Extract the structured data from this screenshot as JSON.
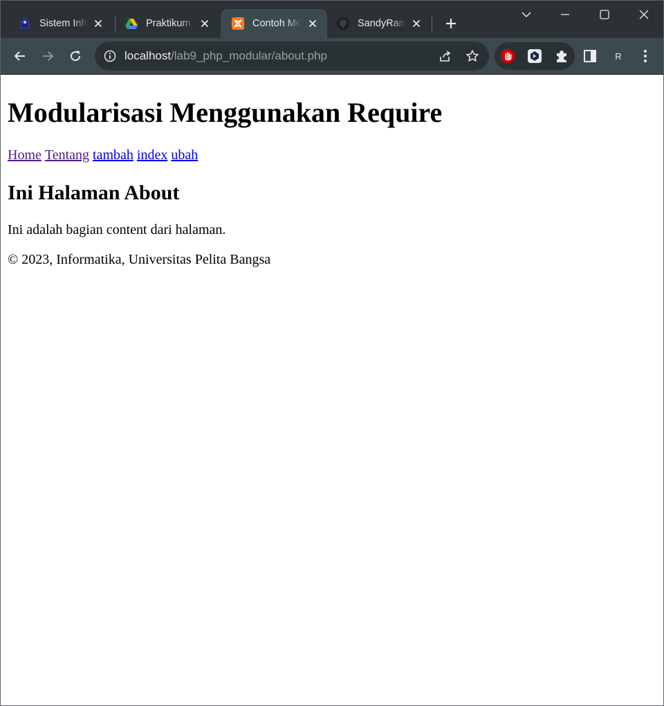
{
  "browser": {
    "tabs": [
      {
        "title": "Sistem Informasi",
        "icon": "university-logo-icon",
        "active": false
      },
      {
        "title": "Praktikum",
        "icon": "google-drive-icon",
        "active": false
      },
      {
        "title": "Contoh Modularisasi",
        "icon": "xampp-icon",
        "active": true
      },
      {
        "title": "SandyRamadhan",
        "icon": "github-icon",
        "active": false
      }
    ],
    "address": {
      "host": "localhost",
      "path": "/lab9_php_modular/about.php"
    },
    "profile_initial": "R",
    "colors": {
      "tabstrip": "#2b3134",
      "toolbar": "#3c4a50",
      "omnibox": "#2a3134",
      "text": "#e8eaed",
      "muted_text": "#9aa0a6"
    }
  },
  "page": {
    "title": "Modularisasi Menggunakan Require",
    "nav": [
      {
        "label": "Home",
        "visited": true
      },
      {
        "label": "Tentang",
        "visited": true
      },
      {
        "label": "tambah",
        "visited": false
      },
      {
        "label": "index",
        "visited": false
      },
      {
        "label": "ubah",
        "visited": false
      }
    ],
    "heading": "Ini Halaman About",
    "content": "Ini adalah bagian content dari halaman.",
    "footer": "© 2023, Informatika, Universitas Pelita Bangsa",
    "colors": {
      "visited_link": "#551a8b",
      "link": "#0000ee"
    }
  }
}
